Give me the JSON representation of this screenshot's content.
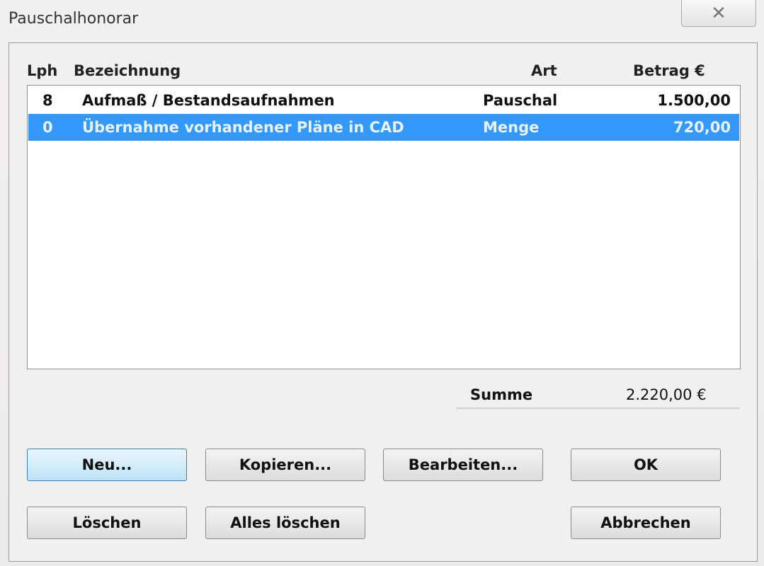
{
  "window": {
    "title": "Pauschalhonorar"
  },
  "columns": {
    "lph": "Lph",
    "bezeichnung": "Bezeichnung",
    "art": "Art",
    "betrag": "Betrag  €"
  },
  "rows": [
    {
      "lph": "8",
      "bezeichnung": "Aufmaß / Bestandsaufnahmen",
      "art": "Pauschal",
      "betrag": "1.500,00"
    },
    {
      "lph": "0",
      "bezeichnung": "Übernahme vorhandener Pläne in CAD",
      "art": "Menge",
      "betrag": "720,00"
    }
  ],
  "summary": {
    "label": "Summe",
    "value": "2.220,00  €"
  },
  "buttons": {
    "neu": "Neu...",
    "kopieren": "Kopieren...",
    "bearbeiten": "Bearbeiten...",
    "ok": "OK",
    "loeschen": "Löschen",
    "alles_loeschen": "Alles löschen",
    "abbrechen": "Abbrechen"
  },
  "icons": {
    "close": "close-icon"
  },
  "colors": {
    "selection": "#3399ff",
    "default_button": "#bfe3f7"
  }
}
